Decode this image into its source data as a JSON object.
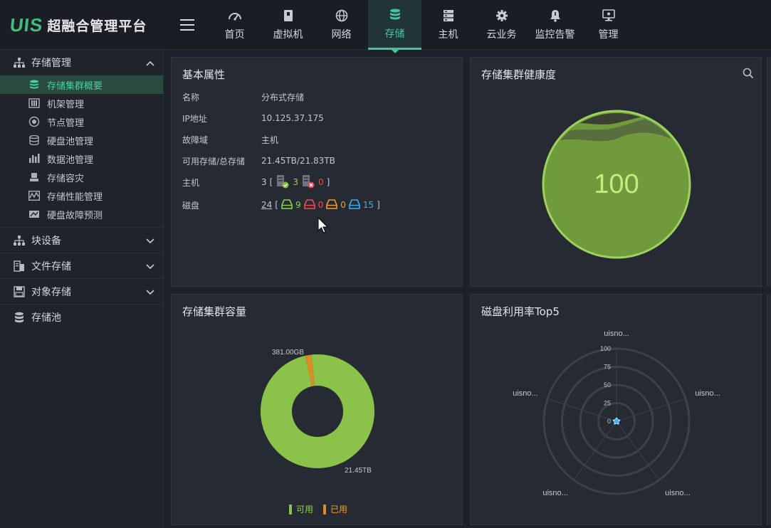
{
  "app": {
    "logo_mark": "UIS",
    "title": "超融合管理平台"
  },
  "nav": [
    {
      "label": "首页",
      "icon": "dashboard-icon"
    },
    {
      "label": "虚拟机",
      "icon": "vm-icon"
    },
    {
      "label": "网络",
      "icon": "globe-icon"
    },
    {
      "label": "存储",
      "icon": "database-icon",
      "active": true
    },
    {
      "label": "主机",
      "icon": "server-icon"
    },
    {
      "label": "云业务",
      "icon": "gear-icon"
    },
    {
      "label": "监控告警",
      "icon": "bell-icon"
    },
    {
      "label": "管理",
      "icon": "monitor-icon"
    }
  ],
  "sidebar": {
    "storage_mgmt": "存储管理",
    "items": [
      {
        "label": "存储集群概要",
        "icon": "cluster-icon",
        "active": true
      },
      {
        "label": "机架管理",
        "icon": "rack-icon"
      },
      {
        "label": "节点管理",
        "icon": "node-icon"
      },
      {
        "label": "硬盘池管理",
        "icon": "disk-pool-icon"
      },
      {
        "label": "数据池管理",
        "icon": "data-pool-icon"
      },
      {
        "label": "存储容灾",
        "icon": "disaster-recovery-icon"
      },
      {
        "label": "存储性能管理",
        "icon": "performance-icon"
      },
      {
        "label": "硬盘故障预测",
        "icon": "disk-prediction-icon"
      }
    ],
    "block_device": "块设备",
    "file_storage": "文件存储",
    "object_storage": "对象存储",
    "storage_pool": "存储池"
  },
  "basic": {
    "title": "基本属性",
    "name_k": "名称",
    "name_v": "分布式存储",
    "ip_k": "IP地址",
    "ip_v": "10.125.37.175",
    "fault_k": "故障域",
    "fault_v": "主机",
    "cap_k": "可用存储/总存储",
    "cap_v": "21.45TB/21.83TB",
    "host_k": "主机",
    "host_total": "3",
    "host_ok": "3",
    "host_err": "0",
    "disk_k": "磁盘",
    "disk_total": "24",
    "disk_ok": "9",
    "disk_red": "0",
    "disk_orange": "0",
    "disk_blue": "15",
    "bracket_open": "[",
    "bracket_close": "]"
  },
  "health": {
    "title": "存储集群健康度",
    "score": "100",
    "level": 1.0
  },
  "capacity": {
    "title": "存储集群容量",
    "legend_available": "可用",
    "legend_used": "已用",
    "colors": {
      "available": "#8bc34a",
      "used": "#e08a24"
    }
  },
  "top5": {
    "title": "磁盘利用率Top5"
  },
  "chart_data": [
    {
      "type": "pie",
      "title": "存储集群容量",
      "slices": [
        {
          "name": "可用",
          "value": 21.45,
          "unit": "TB",
          "label": "21.45TB"
        },
        {
          "name": "已用",
          "value": 0.381,
          "unit": "TB",
          "label": "381.00GB"
        }
      ],
      "donut": true
    },
    {
      "type": "radar",
      "title": "磁盘利用率Top5",
      "indicators": [
        "uisno...",
        "uisno...",
        "uisno...",
        "uisno...",
        "uisno..."
      ],
      "radial_ticks": [
        "100",
        "75",
        "50",
        "25",
        "0"
      ],
      "rlim": [
        0,
        100
      ],
      "values": [
        2,
        2,
        2,
        2,
        2
      ]
    }
  ]
}
